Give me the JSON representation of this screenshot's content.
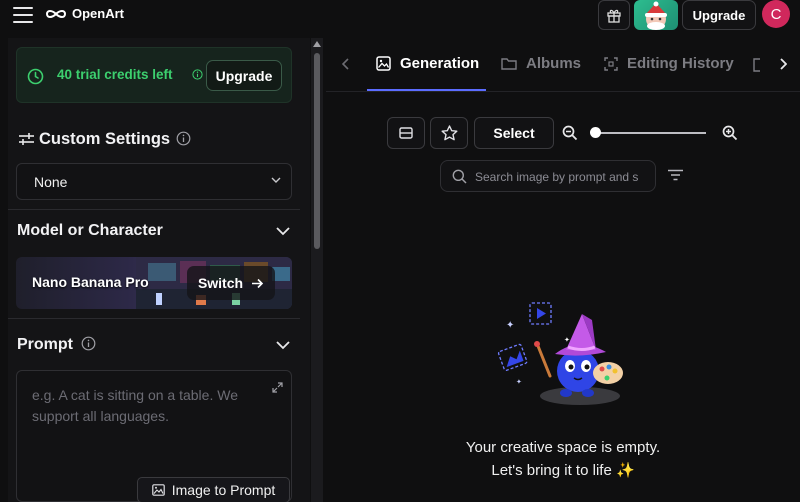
{
  "header": {
    "brand": "OpenArt",
    "upgrade_label": "Upgrade",
    "user_initial": "C"
  },
  "sidebar": {
    "trial": {
      "text": "40 trial credits left",
      "upgrade_label": "Upgrade"
    },
    "custom_settings": {
      "title": "Custom Settings",
      "selected": "None"
    },
    "model": {
      "title": "Model or Character",
      "name": "Nano Banana Pro",
      "switch_label": "Switch"
    },
    "prompt": {
      "title": "Prompt",
      "placeholder": "e.g. A cat is sitting on a table. We support all languages.",
      "image_to_prompt_label": "Image to Prompt"
    }
  },
  "main": {
    "tabs": [
      {
        "label": "Generation",
        "icon": "image-icon",
        "active": true
      },
      {
        "label": "Albums",
        "icon": "folder-icon",
        "active": false
      },
      {
        "label": "Editing History",
        "icon": "history-icon",
        "active": false
      }
    ],
    "toolbar": {
      "select_label": "Select",
      "zoom_level": 0.0
    },
    "search": {
      "placeholder": "Search image by prompt and s"
    },
    "empty_state": {
      "line1": "Your creative space is empty.",
      "line2": "Let's bring it to life ✨"
    }
  },
  "colors": {
    "accent": "#5b6cff",
    "trial_green": "#3ccf6e",
    "avatar": "#d0285c"
  }
}
